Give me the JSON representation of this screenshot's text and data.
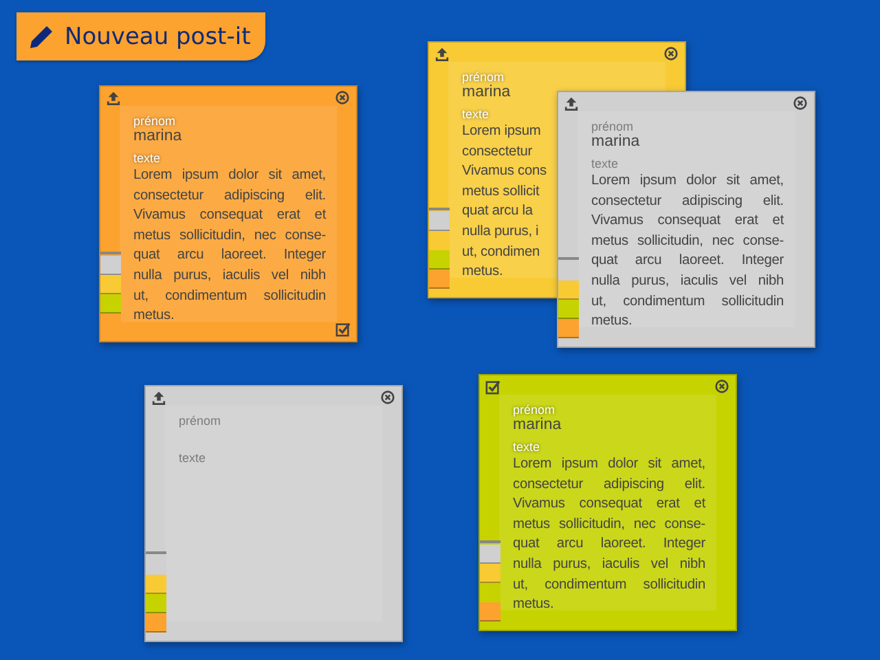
{
  "new_button": {
    "label": "Nouveau post-it"
  },
  "notes": [
    {
      "color": "#fca22f",
      "done": false,
      "bottom_check": true,
      "name_label": "prénom",
      "name_value": "marina",
      "text_label": "texte",
      "text_lines": [
        "Lorem ipsum dolor sit amet,",
        "consectetur adipiscing elit.",
        "Vivamus consequat erat et",
        "metus sollicitudin, nec conse-",
        "quat arcu laoreet. Integer",
        "nulla purus, iaculis vel nibh",
        "ut, condimentum sollicitudin",
        "metus."
      ],
      "swatches": [
        {
          "color": "#d0d0d0",
          "selected": false
        },
        {
          "color": "#f8cb35",
          "selected": false
        },
        {
          "color": "#c6d300",
          "selected": false
        },
        {
          "color": "#fca22f",
          "selected": true
        }
      ]
    },
    {
      "color": "#f8cb35",
      "done": false,
      "bottom_check": false,
      "name_label": "prénom",
      "name_value": "marina",
      "text_label": "texte",
      "text_lines": [
        "Lorem ipsum",
        "consectetur",
        "Vivamus cons",
        "metus sollicit",
        "quat arcu la",
        "nulla purus, i",
        "ut, condimen",
        "metus."
      ],
      "swatches": [
        {
          "color": "#d0d0d0",
          "selected": false
        },
        {
          "color": "#f8cb35",
          "selected": true
        },
        {
          "color": "#c6d300",
          "selected": false
        },
        {
          "color": "#fca22f",
          "selected": false
        }
      ]
    },
    {
      "color": "#d0d0d0",
      "done": false,
      "bottom_check": false,
      "name_label": "prénom",
      "name_value": "marina",
      "text_label": "texte",
      "text_lines": [
        "Lorem ipsum dolor sit amet,",
        "consectetur adipiscing elit.",
        "Vivamus consequat erat et",
        "metus sollicitudin, nec conse-",
        "quat arcu laoreet. Integer",
        "nulla purus, iaculis vel nibh",
        "ut, condimentum sollicitudin",
        "metus."
      ],
      "swatches": [
        {
          "color": "#d0d0d0",
          "selected": true
        },
        {
          "color": "#f8cb35",
          "selected": false
        },
        {
          "color": "#c6d300",
          "selected": false
        },
        {
          "color": "#fca22f",
          "selected": false
        }
      ]
    },
    {
      "color": "#d0d0d0",
      "done": false,
      "bottom_check": false,
      "name_label": "prénom",
      "text_label": "texte",
      "swatches": [
        {
          "color": "#d0d0d0",
          "selected": true
        },
        {
          "color": "#f8cb35",
          "selected": false
        },
        {
          "color": "#c6d300",
          "selected": false
        },
        {
          "color": "#fca22f",
          "selected": false
        }
      ]
    },
    {
      "color": "#c6d300",
      "done": true,
      "bottom_check": false,
      "name_label": "prénom",
      "name_value": "marina",
      "text_label": "texte",
      "text_lines": [
        "Lorem ipsum dolor sit amet,",
        "consectetur adipiscing elit.",
        "Vivamus consequat erat et",
        "metus sollicitudin, nec conse-",
        "quat arcu laoreet. Integer",
        "nulla purus, iaculis vel nibh",
        "ut, condimentum sollicitudin",
        "metus."
      ],
      "swatches": [
        {
          "color": "#d0d0d0",
          "selected": false
        },
        {
          "color": "#f8cb35",
          "selected": false
        },
        {
          "color": "#c6d300",
          "selected": true
        },
        {
          "color": "#fca22f",
          "selected": false
        }
      ]
    }
  ]
}
